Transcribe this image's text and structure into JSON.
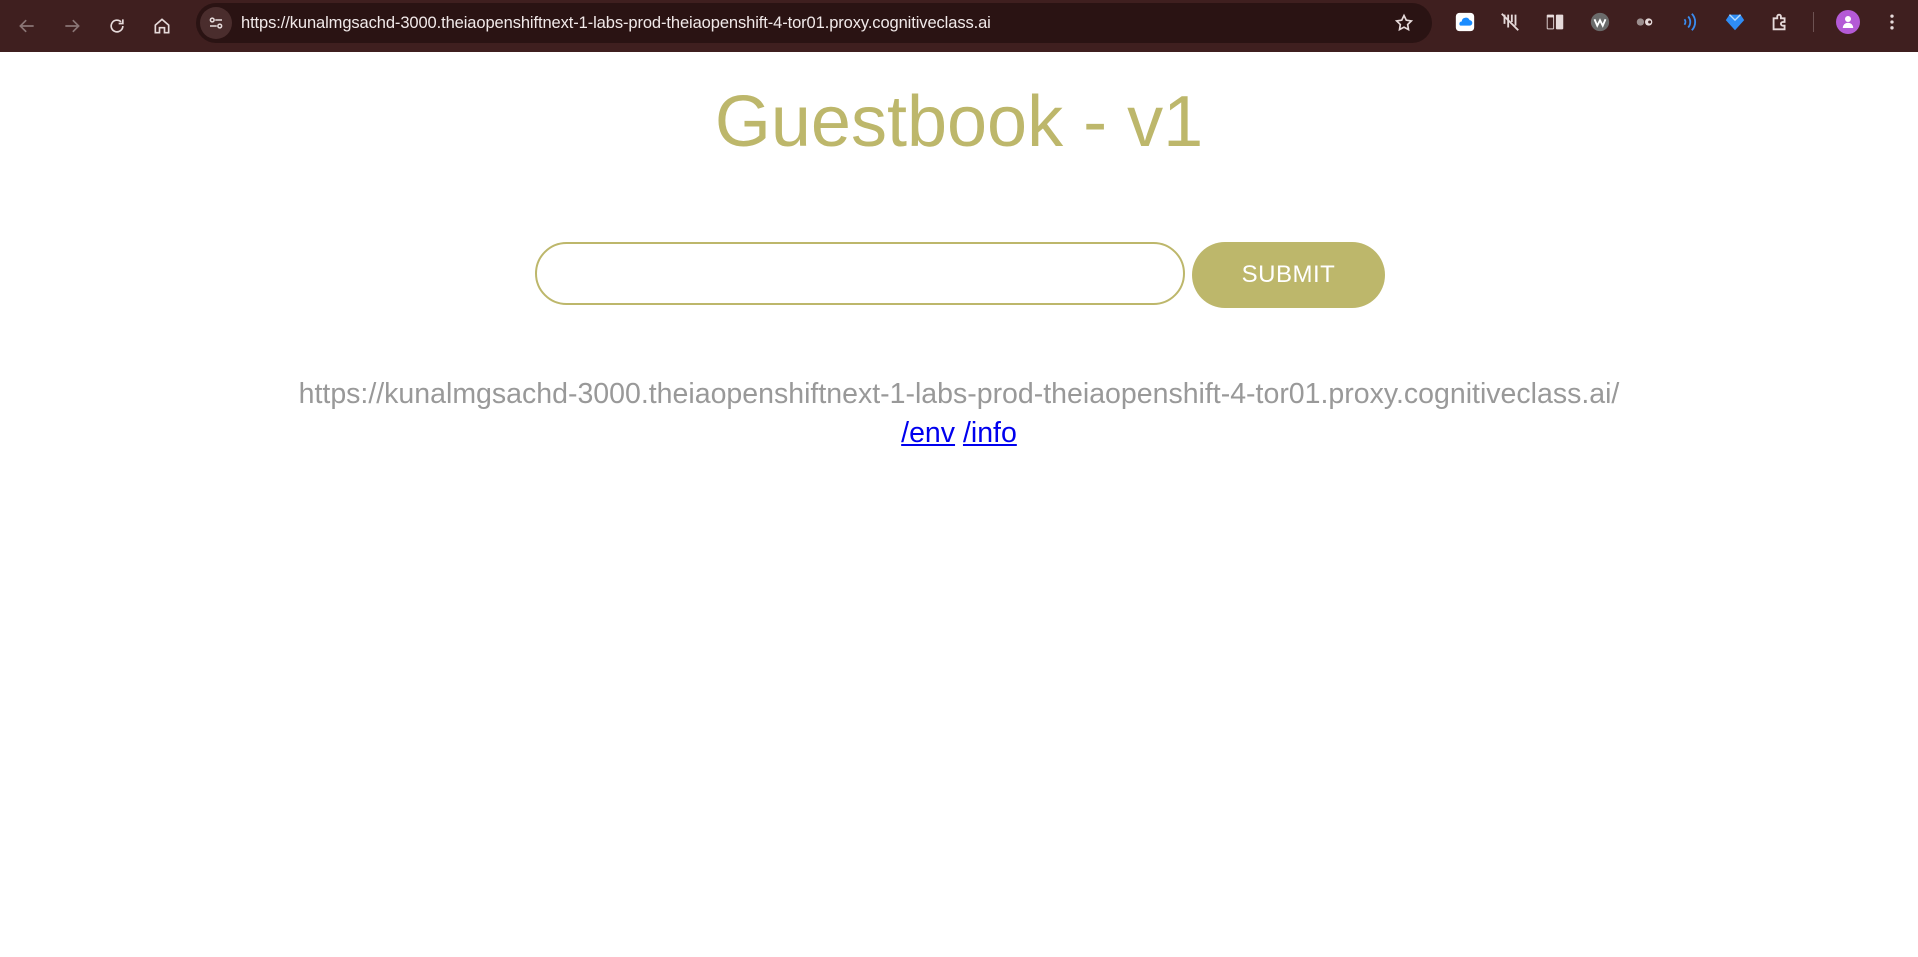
{
  "browser": {
    "url": "https://kunalmgsachd-3000.theiaopenshiftnext-1-labs-prod-theiaopenshift-4-tor01.proxy.cognitiveclass.ai",
    "nav_icons": [
      "back-arrow-icon",
      "forward-arrow-icon",
      "reload-icon",
      "home-icon"
    ],
    "site_info_icon": "tune-icon",
    "bookmark_icon": "star-icon",
    "extension_icons": [
      "cloud-icon",
      "no-tracking-icon",
      "split-view-icon",
      "w-logo-icon",
      "toggle-icon",
      "wifi-signal-icon",
      "gem-icon",
      "puzzle-icon"
    ],
    "profile_icon": "avatar-icon",
    "menu_icon": "kebab-menu-icon",
    "colors": {
      "toolbar": "#3f1f1f",
      "omnibox": "#2a1313"
    }
  },
  "page": {
    "title": "Guestbook - v1",
    "input_value": "",
    "submit_label": "SUBMIT",
    "base_url": "https://kunalmgsachd-3000.theiaopenshiftnext-1-labs-prod-theiaopenshift-4-tor01.proxy.cognitiveclass.ai/",
    "links": [
      {
        "label": "/env"
      },
      {
        "label": "/info"
      }
    ],
    "colors": {
      "accent": "#bdb76b",
      "url_text": "#999999",
      "link": "#0000ee"
    }
  }
}
